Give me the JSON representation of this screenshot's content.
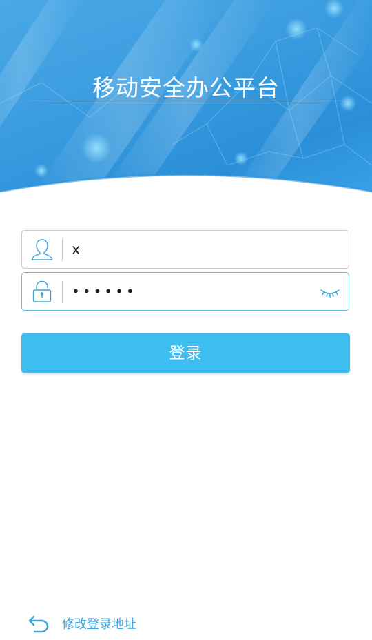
{
  "header": {
    "title": "移动安全办公平台"
  },
  "form": {
    "username": {
      "value": "x",
      "icon": "user-icon"
    },
    "password": {
      "value": "••••••",
      "icon": "lock-icon",
      "toggle_icon": "eye-closed-icon"
    },
    "login_label": "登录"
  },
  "footer": {
    "change_address_label": "修改登录地址",
    "icon": "back-arrow-icon"
  },
  "colors": {
    "header_blue": "#3b9de0",
    "accent": "#3ebdf0",
    "link": "#3aa6dc"
  }
}
